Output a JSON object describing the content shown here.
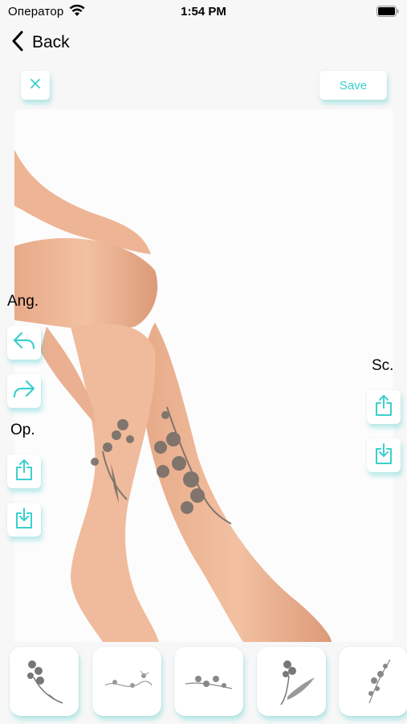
{
  "status_bar": {
    "carrier": "Оператор",
    "time": "1:54 PM"
  },
  "nav": {
    "back_label": "Back"
  },
  "toolbar": {
    "save_label": "Save"
  },
  "controls": {
    "angle_label": "Ang.",
    "opacity_label": "Op.",
    "scale_label": "Sc."
  },
  "icons": {
    "close": "close-icon",
    "undo": "undo-arrow-icon",
    "redo": "redo-arrow-icon",
    "increase": "share-up-icon",
    "decrease": "download-icon"
  },
  "thumbnails": [
    {
      "name": "orchid-stem-tattoo"
    },
    {
      "name": "floral-script-tattoo"
    },
    {
      "name": "orchid-branch-tattoo"
    },
    {
      "name": "lily-leaf-tattoo"
    },
    {
      "name": "orchid-spray-tattoo"
    }
  ],
  "colors": {
    "accent": "#3ccfcf",
    "background": "#f7f7f7"
  }
}
